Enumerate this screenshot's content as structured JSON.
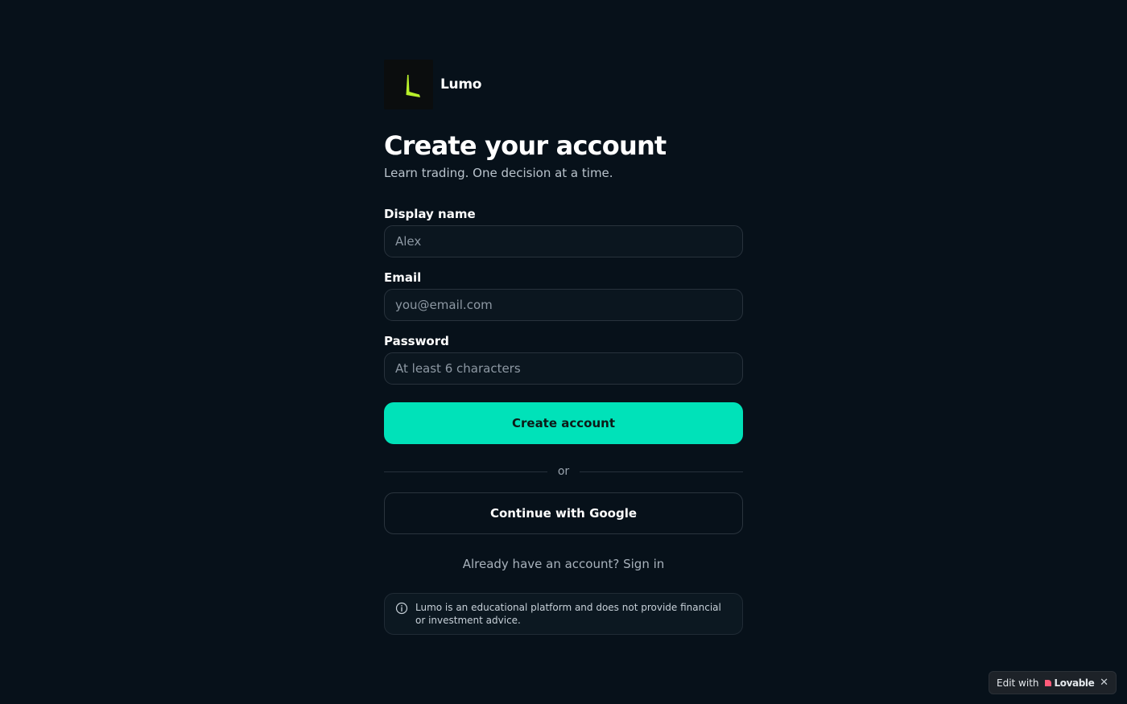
{
  "brand": {
    "name": "Lumo",
    "logo_color": "#b8f02a"
  },
  "heading": {
    "title": "Create your account",
    "subtitle": "Learn trading. One decision at a time."
  },
  "form": {
    "display_name": {
      "label": "Display name",
      "placeholder": "Alex",
      "value": ""
    },
    "email": {
      "label": "Email",
      "placeholder": "you@email.com",
      "value": ""
    },
    "password": {
      "label": "Password",
      "placeholder": "At least 6 characters",
      "value": ""
    },
    "submit_label": "Create account",
    "divider_label": "or",
    "google_label": "Continue with Google",
    "signin_prompt": "Already have an account?",
    "signin_link": "Sign in"
  },
  "disclaimer": {
    "icon": "info-icon",
    "text": "Lumo is an educational platform and does not provide financial or investment advice."
  },
  "badge": {
    "prefix": "Edit with",
    "brand": "Lovable",
    "close": "✕"
  },
  "colors": {
    "background": "#07111a",
    "accent": "#00e2b9",
    "input_border": "#28323c"
  }
}
